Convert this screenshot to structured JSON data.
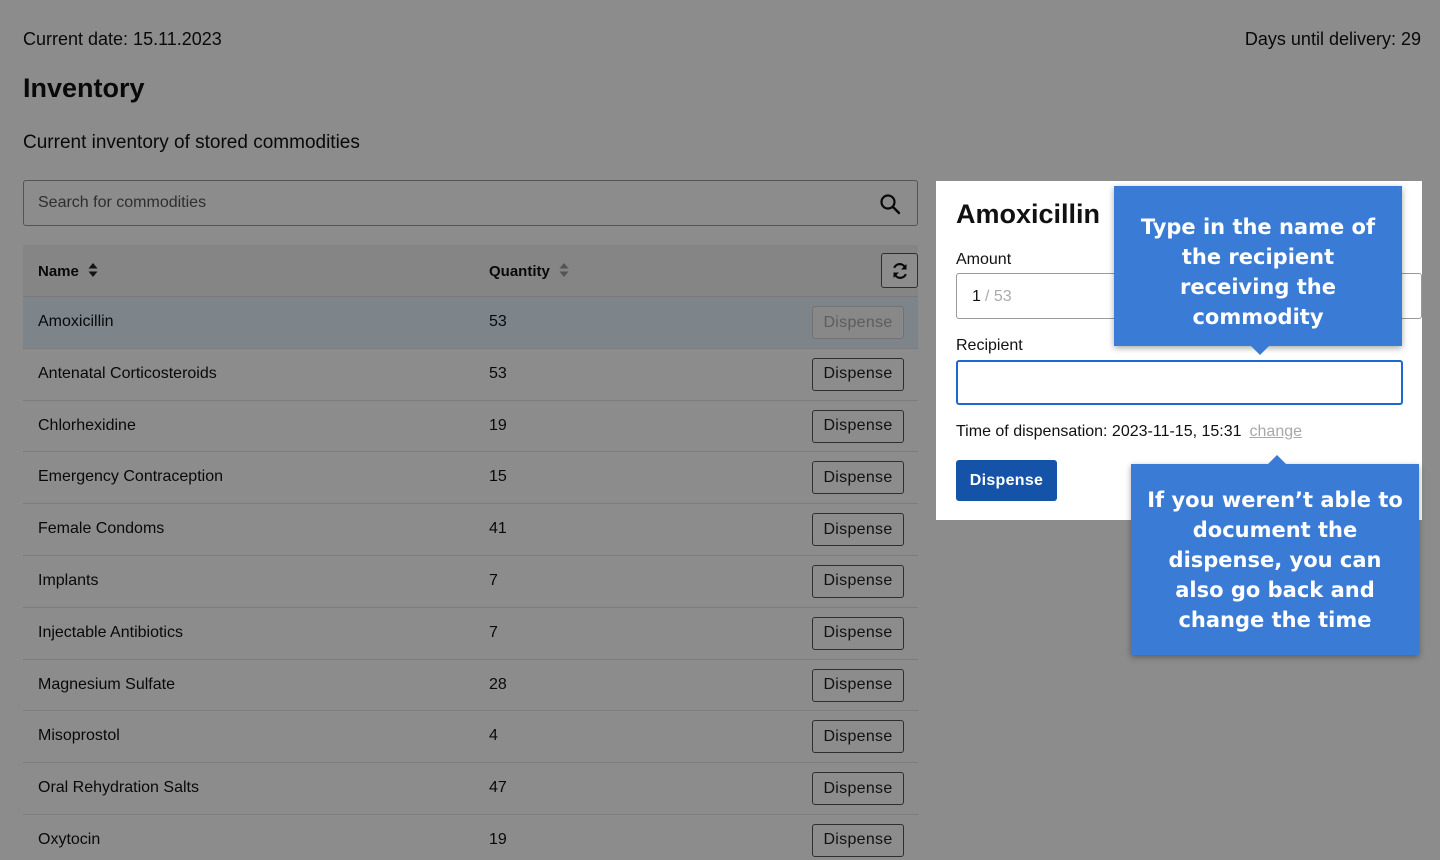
{
  "header": {
    "current_date": "Current date: 15.11.2023",
    "days_until_delivery": "Days until delivery: 29"
  },
  "page": {
    "title": "Inventory",
    "subtitle": "Current inventory of stored commodities"
  },
  "search": {
    "placeholder": "Search for commodities"
  },
  "table": {
    "columns": {
      "name": "Name",
      "quantity": "Quantity"
    },
    "action_label": "Dispense",
    "rows": [
      {
        "name": "Amoxicillin",
        "quantity": "53",
        "selected": true
      },
      {
        "name": "Antenatal Corticosteroids",
        "quantity": "53"
      },
      {
        "name": "Chlorhexidine",
        "quantity": "19"
      },
      {
        "name": "Emergency Contraception",
        "quantity": "15"
      },
      {
        "name": "Female Condoms",
        "quantity": "41"
      },
      {
        "name": "Implants",
        "quantity": "7"
      },
      {
        "name": "Injectable Antibiotics",
        "quantity": "7"
      },
      {
        "name": "Magnesium Sulfate",
        "quantity": "28"
      },
      {
        "name": "Misoprostol",
        "quantity": "4"
      },
      {
        "name": "Oral Rehydration Salts",
        "quantity": "47"
      },
      {
        "name": "Oxytocin",
        "quantity": "19"
      }
    ]
  },
  "panel": {
    "title": "Amoxicillin",
    "amount_label": "Amount",
    "amount_value": "1",
    "amount_max": "/ 53",
    "recipient_label": "Recipient",
    "recipient_value": "",
    "time_label": "Time of dispensation: 2023-11-15, 15:31",
    "change_label": "change",
    "dispense_label": "Dispense"
  },
  "tooltips": {
    "recipient": "Type in the name of the recipient receiving the commodity",
    "change_time": "If you weren’t able to document the dispense, you can also go back and change the time"
  },
  "icons": {
    "search": "search-icon",
    "sort": "sort-icon",
    "refresh": "refresh-icon"
  },
  "colors": {
    "primary": "#1553a8",
    "focus": "#1b6ad3",
    "tooltip": "#3a7bd5",
    "selected_row": "#e3f0fb"
  }
}
